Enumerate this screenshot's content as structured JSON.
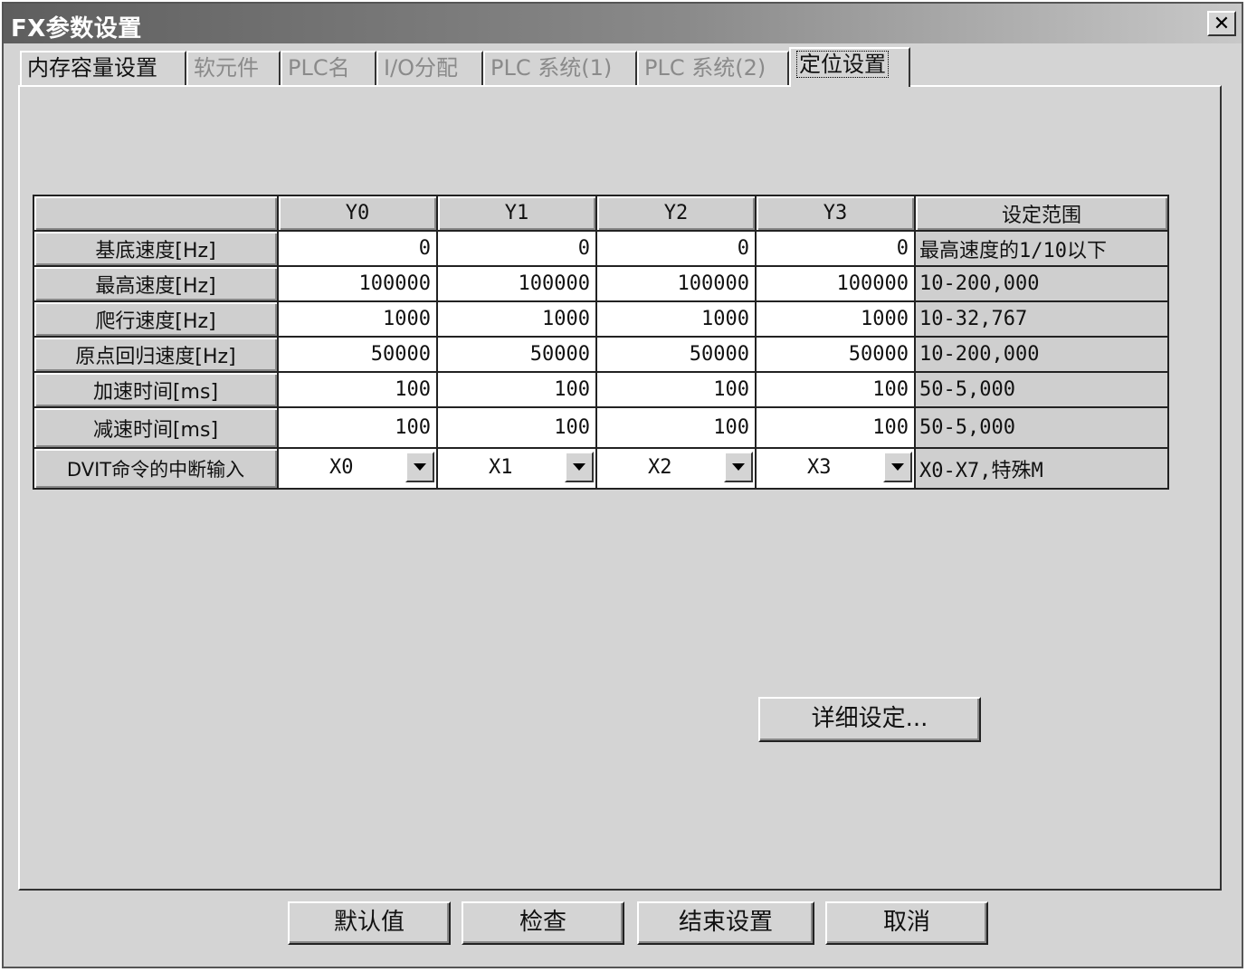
{
  "window": {
    "title": "FX参数设置",
    "close_label": "✕"
  },
  "tabs": [
    {
      "label": "内存容量设置",
      "state": "enabled"
    },
    {
      "label": "软元件",
      "state": "disabled"
    },
    {
      "label": "PLC名",
      "state": "disabled"
    },
    {
      "label": "I/O分配",
      "state": "disabled"
    },
    {
      "label": "PLC 系统(1)",
      "state": "disabled"
    },
    {
      "label": "PLC 系统(2)",
      "state": "disabled"
    },
    {
      "label": "定位设置",
      "state": "active"
    }
  ],
  "table": {
    "headers": [
      "",
      "Y0",
      "Y1",
      "Y2",
      "Y3",
      "设定范围"
    ],
    "rows": [
      {
        "label": "基底速度[Hz]",
        "values": [
          "0",
          "0",
          "0",
          "0"
        ],
        "range": "最高速度的1/10以下"
      },
      {
        "label": "最高速度[Hz]",
        "values": [
          "100000",
          "100000",
          "100000",
          "100000"
        ],
        "range": "10-200,000"
      },
      {
        "label": "爬行速度[Hz]",
        "values": [
          "1000",
          "1000",
          "1000",
          "1000"
        ],
        "range": "10-32,767"
      },
      {
        "label": "原点回归速度[Hz]",
        "values": [
          "50000",
          "50000",
          "50000",
          "50000"
        ],
        "range": "10-200,000"
      },
      {
        "label": "加速时间[ms]",
        "values": [
          "100",
          "100",
          "100",
          "100"
        ],
        "range": "50-5,000"
      },
      {
        "label": "减速时间[ms]",
        "values": [
          "100",
          "100",
          "100",
          "100"
        ],
        "range": "50-5,000"
      }
    ],
    "interrupt_row": {
      "label": "DVIT命令的中断输入",
      "values": [
        "X0",
        "X1",
        "X2",
        "X3"
      ],
      "range": "X0-X7,特殊M"
    }
  },
  "detail_button": "详细设定...",
  "footer_buttons": {
    "default": "默认值",
    "check": "检查",
    "finish": "结束设置",
    "cancel": "取消"
  }
}
